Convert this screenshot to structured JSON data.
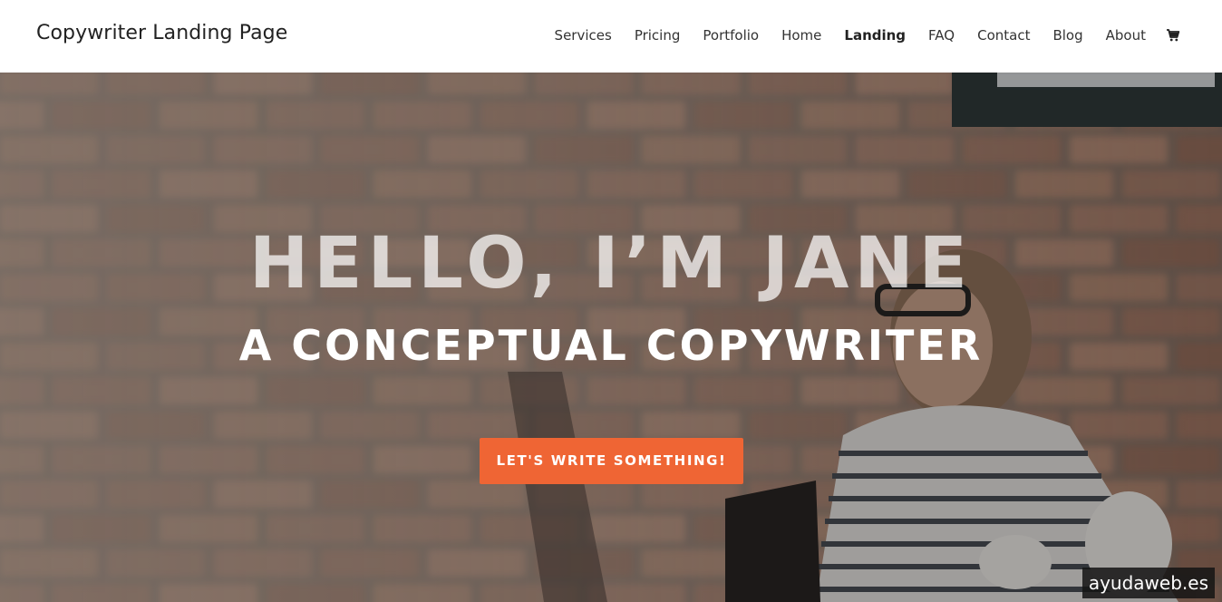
{
  "site": {
    "title": "Copywriter Landing Page"
  },
  "nav": {
    "items": [
      {
        "label": "Services"
      },
      {
        "label": "Pricing"
      },
      {
        "label": "Portfolio"
      },
      {
        "label": "Home"
      },
      {
        "label": "Landing",
        "active": true
      },
      {
        "label": "FAQ"
      },
      {
        "label": "Contact"
      },
      {
        "label": "Blog"
      },
      {
        "label": "About"
      }
    ],
    "cart_icon": "shopping-cart-icon"
  },
  "hero": {
    "title": "HELLO, I’M JANE",
    "subtitle": "A CONCEPTUAL COPYWRITER",
    "cta_label": "LET'S WRITE SOMETHING!",
    "cta_color": "#ef6534"
  },
  "watermark": {
    "text": "ayudaweb.es"
  }
}
